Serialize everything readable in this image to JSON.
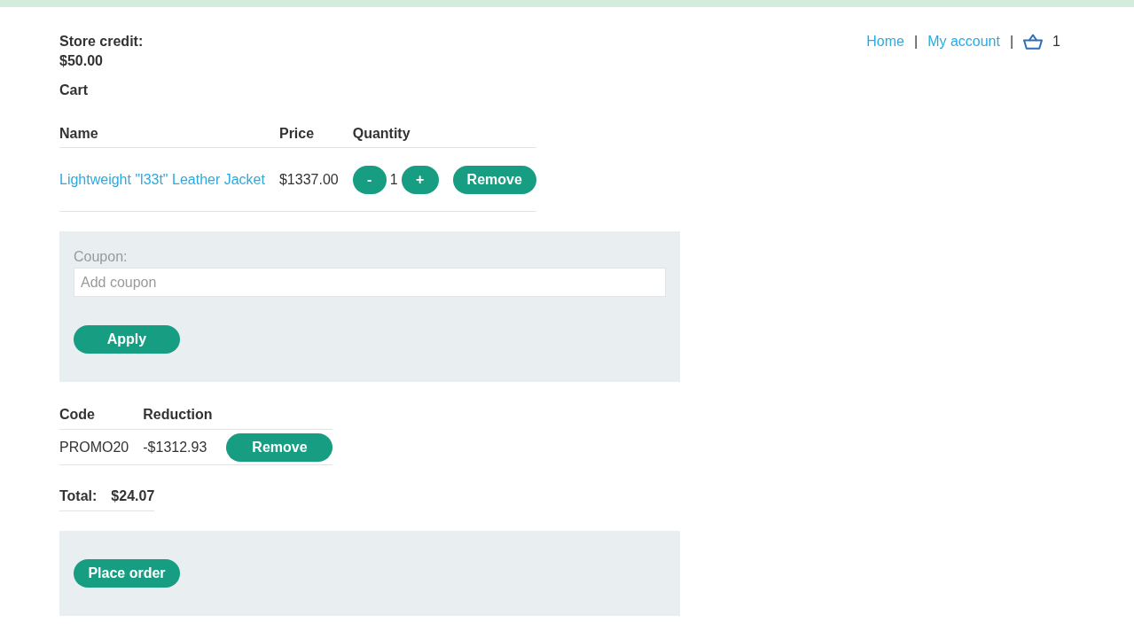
{
  "store_credit": {
    "label": "Store credit:",
    "value": "$50.00"
  },
  "nav": [
    {
      "kind": "link",
      "text": "Home"
    },
    {
      "kind": "separator",
      "text": "|"
    },
    {
      "kind": "link",
      "text": "My account"
    },
    {
      "kind": "separator",
      "text": "|"
    },
    {
      "kind": "cart",
      "text": "1"
    }
  ],
  "cart": {
    "title": "Cart",
    "columns": [
      "Name",
      "Price",
      "Quantity"
    ],
    "rows": [
      {
        "name": "Lightweight \"l33t\" Leather Jacket",
        "price": "$1337.00",
        "decrease": "-",
        "quantity": "1",
        "increase": "+",
        "remove": "Remove"
      }
    ]
  },
  "coupon": {
    "label": "Coupon:",
    "placeholder": "Add coupon",
    "button": "Apply"
  },
  "discounts": {
    "columns": [
      "Code",
      "Reduction"
    ],
    "rows": [
      {
        "code": "PROMO20",
        "reduction": "-$1312.93",
        "remove": "Remove"
      }
    ]
  },
  "total": {
    "label": "Total:",
    "value": "$24.07"
  },
  "order": {
    "button": "Place order"
  }
}
